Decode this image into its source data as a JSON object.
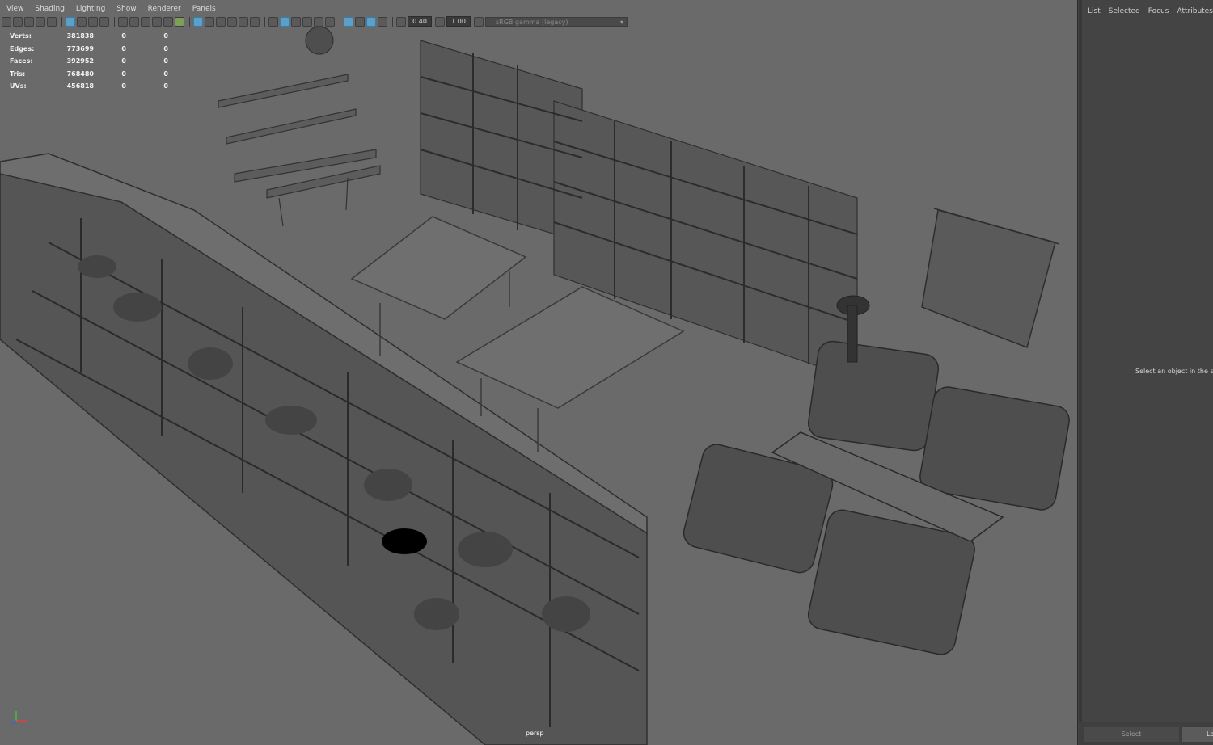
{
  "menu": [
    "View",
    "Shading",
    "Lighting",
    "Show",
    "Renderer",
    "Panels"
  ],
  "toolbar": {
    "exposure": "0.40",
    "gamma": "1.00",
    "color_space": "sRGB gamma (legacy)"
  },
  "hud": {
    "rows": [
      {
        "label": "Verts:",
        "v1": "381838",
        "v2": "0",
        "v3": "0"
      },
      {
        "label": "Edges:",
        "v1": "773699",
        "v2": "0",
        "v3": "0"
      },
      {
        "label": "Faces:",
        "v1": "392952",
        "v2": "0",
        "v3": "0"
      },
      {
        "label": "Tris:",
        "v1": "768480",
        "v2": "0",
        "v3": "0"
      },
      {
        "label": "UVs:",
        "v1": "456818",
        "v2": "0",
        "v3": "0"
      }
    ]
  },
  "viewport": {
    "camera": "persp",
    "colors": {
      "background": "#6a6a6a",
      "geometry": "#5a5a5a"
    }
  },
  "right_panel": {
    "tabs": [
      "List",
      "Selected",
      "Focus",
      "Attributes"
    ],
    "hint": "Select an object in the s",
    "select_button": "Select",
    "lo_button": "Lo"
  },
  "icons": [
    "camera-icon",
    "wireframe-icon",
    "smooth-shade-icon",
    "grid-icon",
    "xray-icon",
    "light-icon",
    "exposure-icon",
    "gamma-icon"
  ]
}
